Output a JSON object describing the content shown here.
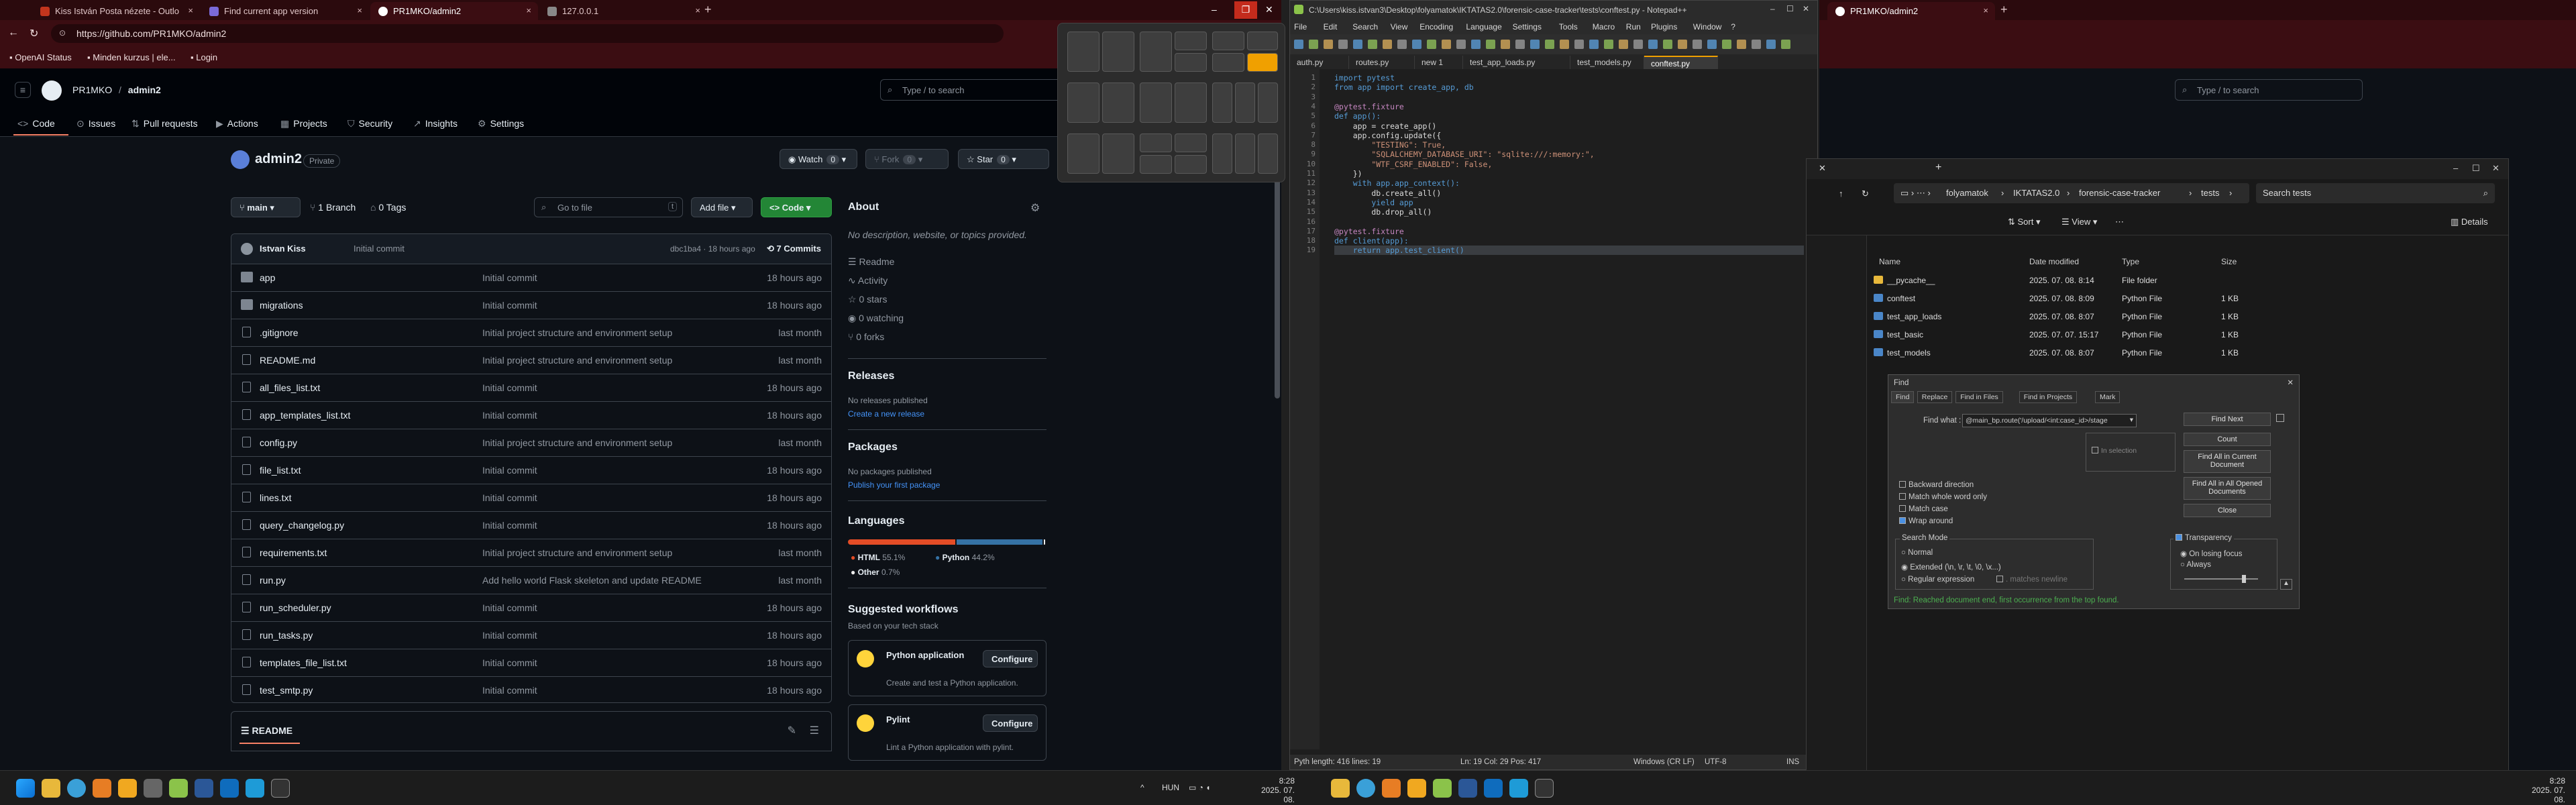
{
  "browser": {
    "tabs": [
      {
        "label": "Kiss István Posta nézete - Outlo",
        "color": "#c2351d"
      },
      {
        "label": "Find current app version",
        "color": "#7a6ad8"
      },
      {
        "label": "PR1MKO/admin2",
        "color": "#ffffff"
      },
      {
        "label": "127.0.0.1",
        "color": "#888888"
      }
    ],
    "url": "https://github.com/PR1MKO/admin2",
    "bookmarks": [
      "OpenAI Status",
      "Minden kurzus | ele...",
      "Login"
    ]
  },
  "github": {
    "owner": "PR1MKO",
    "repo": "admin2",
    "search_placeholder": "Type / to search",
    "nav_tabs": [
      "Code",
      "Issues",
      "Pull requests",
      "Actions",
      "Projects",
      "Security",
      "Insights",
      "Settings"
    ],
    "repo_title": "admin2",
    "visibility": "Private",
    "watch_label": "Watch",
    "watch_count": "0",
    "fork_label": "Fork",
    "fork_count": "0",
    "star_label": "Star",
    "star_count": "0",
    "branch_name": "main",
    "branches": "1 Branch",
    "tags": "0 Tags",
    "goto_file": "Go to file",
    "goto_key": "t",
    "add_file": "Add file",
    "code_button": "Code",
    "commit_author": "Istvan Kiss",
    "commit_msg": "Initial commit",
    "commit_hash": "dbc1ba4 · 18 hours ago",
    "commit_count": "7 Commits",
    "files": [
      {
        "name": "app",
        "type": "dir",
        "msg": "Initial commit",
        "date": "18 hours ago"
      },
      {
        "name": "migrations",
        "type": "dir",
        "msg": "Initial commit",
        "date": "18 hours ago"
      },
      {
        "name": ".gitignore",
        "type": "file",
        "msg": "Initial project structure and environment setup",
        "date": "last month"
      },
      {
        "name": "README.md",
        "type": "file",
        "msg": "Initial project structure and environment setup",
        "date": "last month"
      },
      {
        "name": "all_files_list.txt",
        "type": "file",
        "msg": "Initial commit",
        "date": "18 hours ago"
      },
      {
        "name": "app_templates_list.txt",
        "type": "file",
        "msg": "Initial commit",
        "date": "18 hours ago"
      },
      {
        "name": "config.py",
        "type": "file",
        "msg": "Initial project structure and environment setup",
        "date": "last month"
      },
      {
        "name": "file_list.txt",
        "type": "file",
        "msg": "Initial commit",
        "date": "18 hours ago"
      },
      {
        "name": "lines.txt",
        "type": "file",
        "msg": "Initial commit",
        "date": "18 hours ago"
      },
      {
        "name": "query_changelog.py",
        "type": "file",
        "msg": "Initial commit",
        "date": "18 hours ago"
      },
      {
        "name": "requirements.txt",
        "type": "file",
        "msg": "Initial project structure and environment setup",
        "date": "last month"
      },
      {
        "name": "run.py",
        "type": "file",
        "msg": "Add hello world Flask skeleton and update README",
        "date": "last month"
      },
      {
        "name": "run_scheduler.py",
        "type": "file",
        "msg": "Initial commit",
        "date": "18 hours ago"
      },
      {
        "name": "run_tasks.py",
        "type": "file",
        "msg": "Initial commit",
        "date": "18 hours ago"
      },
      {
        "name": "templates_file_list.txt",
        "type": "file",
        "msg": "Initial commit",
        "date": "18 hours ago"
      },
      {
        "name": "test_smtp.py",
        "type": "file",
        "msg": "Initial commit",
        "date": "18 hours ago"
      }
    ],
    "readme_label": "README",
    "about": {
      "title": "About",
      "desc": "No description, website, or topics provided.",
      "items": [
        "Readme",
        "Activity",
        "0 stars",
        "0 watching",
        "0 forks"
      ]
    },
    "releases": {
      "title": "Releases",
      "none": "No releases published",
      "link": "Create a new release"
    },
    "packages": {
      "title": "Packages",
      "none": "No packages published",
      "link": "Publish your first package"
    },
    "languages": {
      "title": "Languages",
      "items": [
        {
          "name": "HTML",
          "pct": "55.1%",
          "value": 55.1,
          "color": "#e34c26"
        },
        {
          "name": "Python",
          "pct": "44.2%",
          "value": 44.2,
          "color": "#3572A5"
        },
        {
          "name": "Other",
          "pct": "0.7%",
          "value": 0.7,
          "color": "#ededed"
        }
      ]
    },
    "workflows": {
      "title": "Suggested workflows",
      "subtitle": "Based on your tech stack",
      "items": [
        {
          "name": "Python application",
          "desc": "Create and test a Python application.",
          "btn": "Configure"
        },
        {
          "name": "Pylint",
          "desc": "Lint a Python application with pylint.",
          "btn": "Configure"
        }
      ]
    }
  },
  "npp": {
    "title": "C:\\Users\\kiss.istvan3\\Desktop\\folyamatok\\IKTATAS2.0\\forensic-case-tracker\\tests\\conftest.py - Notepad++",
    "menu": [
      "File",
      "Edit",
      "Search",
      "View",
      "Encoding",
      "Language",
      "Settings",
      "Tools",
      "Macro",
      "Run",
      "Plugins",
      "Window",
      "?"
    ],
    "tabs": [
      "auth.py",
      "routes.py",
      "new 1",
      "test_app_loads.py",
      "test_models.py",
      "conftest.py"
    ],
    "code": [
      "import pytest",
      "from app import create_app, db",
      "",
      "@pytest.fixture",
      "def app():",
      "    app = create_app()",
      "    app.config.update({",
      "        \"TESTING\": True,",
      "        \"SQLALCHEMY_DATABASE_URI\": \"sqlite:///:memory:\",",
      "        \"WTF_CSRF_ENABLED\": False,",
      "    })",
      "    with app.app_context():",
      "        db.create_all()",
      "        yield app",
      "        db.drop_all()",
      "",
      "@pytest.fixture",
      "def client(app):",
      "    return app.test_client()"
    ],
    "status": {
      "type": "Pyth  length: 416    lines: 19",
      "pos": "Ln: 19   Col: 29   Pos: 417",
      "eol": "Windows (CR LF)",
      "enc": "UTF-8",
      "ins": "INS"
    }
  },
  "right_browser": {
    "tab": "PR1MKO/admin2",
    "search_placeholder": "Type / to search"
  },
  "explorer": {
    "breadcrumb": [
      "folyamatok",
      "IKTATAS2.0",
      "forensic-case-tracker",
      "tests"
    ],
    "search_placeholder": "Search tests",
    "sort": "Sort",
    "view": "View",
    "details": "Details",
    "headers": [
      "Name",
      "Date modified",
      "Type",
      "Size"
    ],
    "rows": [
      {
        "name": "__pycache__",
        "date": "2025. 07. 08. 8:14",
        "type": "File folder",
        "size": ""
      },
      {
        "name": "conftest",
        "date": "2025. 07. 08. 8:09",
        "type": "Python File",
        "size": "1 KB"
      },
      {
        "name": "test_app_loads",
        "date": "2025. 07. 08. 8:07",
        "type": "Python File",
        "size": "1 KB"
      },
      {
        "name": "test_basic",
        "date": "2025. 07. 07. 15:17",
        "type": "Python File",
        "size": "1 KB"
      },
      {
        "name": "test_models",
        "date": "2025. 07. 08. 8:07",
        "type": "Python File",
        "size": "1 KB"
      }
    ]
  },
  "find": {
    "title": "Find",
    "tabs": [
      "Find",
      "Replace",
      "Find in Files",
      "Find in Projects",
      "Mark"
    ],
    "find_what_label": "Find what :",
    "find_what": "@main_bp.route('/upload/<int:case_id>/stage",
    "in_selection": "In selection",
    "buttons": [
      "Find Next",
      "Count",
      "Find All in Current Document",
      "Find All in All Opened Documents",
      "Close"
    ],
    "options": [
      "Backward direction",
      "Match whole word only",
      "Match case",
      "Wrap around"
    ],
    "search_mode": "Search Mode",
    "modes": [
      "Normal",
      "Extended (\\n, \\r, \\t, \\0, \\x...)",
      "Regular expression"
    ],
    "matches_newline": ". matches newline",
    "transparency": "Transparency",
    "trans_opts": [
      "On losing focus",
      "Always"
    ],
    "status": "Find: Reached document end, first occurrence from the top found."
  },
  "taskbar": {
    "lang": "HUN",
    "time_left": "8:28",
    "date_left": "2025. 07. 08.",
    "time_right": "8:28",
    "date_right": "2025. 07. 08."
  }
}
